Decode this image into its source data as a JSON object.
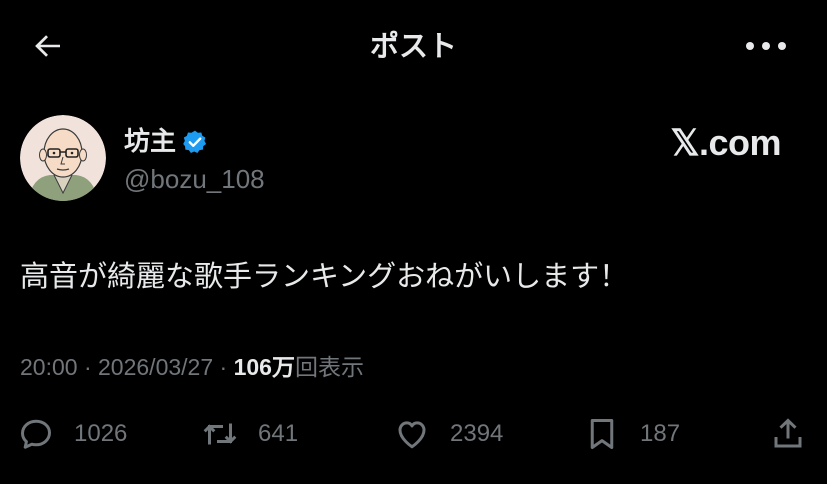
{
  "header": {
    "title": "ポスト"
  },
  "author": {
    "name": "坊主",
    "handle": "@bozu_108",
    "verified": true
  },
  "watermark": "𝕏.com",
  "tweet": {
    "text": "高音が綺麗な歌手ランキングおねがいします！"
  },
  "meta": {
    "time": "20:00",
    "separator": "·",
    "date": "2026/03/27",
    "views_count": "106万",
    "views_label": "回表示"
  },
  "actions": {
    "reply_count": "1026",
    "repost_count": "641",
    "like_count": "2394",
    "bookmark_count": "187"
  },
  "colors": {
    "background": "#000000",
    "text_primary": "#e7e9ea",
    "text_secondary": "#71767b",
    "verified_blue": "#1d9bf0"
  },
  "icons": [
    "back-arrow-icon",
    "more-icon",
    "verified-badge-icon",
    "reply-icon",
    "repost-icon",
    "like-icon",
    "bookmark-icon",
    "share-icon"
  ]
}
